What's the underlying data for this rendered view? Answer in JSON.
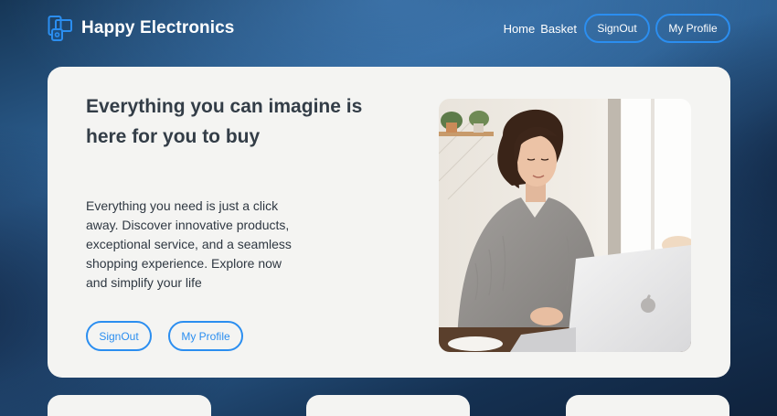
{
  "brand": {
    "name": "Happy Electronics",
    "logo_icon": "devices-icon",
    "accent_color": "#2b8ef0"
  },
  "nav": {
    "home": "Home",
    "basket": "Basket",
    "signout": "SignOut",
    "profile": "My Profile"
  },
  "hero": {
    "title": "Everything you can imagine is here for you to buy",
    "text": "Everything you need is just a click away. Discover innovative products, exceptional service, and a seamless shopping experience. Explore now and simplify your life",
    "signout": "SignOut",
    "profile": "My Profile",
    "image": "woman-using-laptop-photo"
  },
  "cards": [
    "card-1",
    "card-2",
    "card-3"
  ]
}
